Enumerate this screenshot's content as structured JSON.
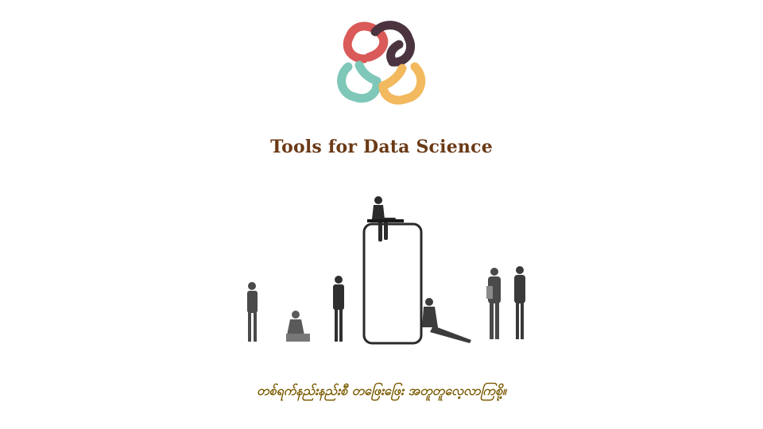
{
  "header": {
    "logo_icon": "interlocking-rings-logo-icon",
    "logo_colors": [
      "#d95a58",
      "#4b3340",
      "#7fc7b8",
      "#f2b95e"
    ]
  },
  "main": {
    "title": "Tools for Data Science",
    "illustration": "people-around-giant-phone-illustration"
  },
  "footer": {
    "tagline": "တစ်ရက်နည်းနည်းစီ တဖြေးဖြေး အတူတူလေ့လာကြစို့။"
  },
  "colors": {
    "title": "#6b3a16",
    "tagline": "#7a5a00"
  }
}
